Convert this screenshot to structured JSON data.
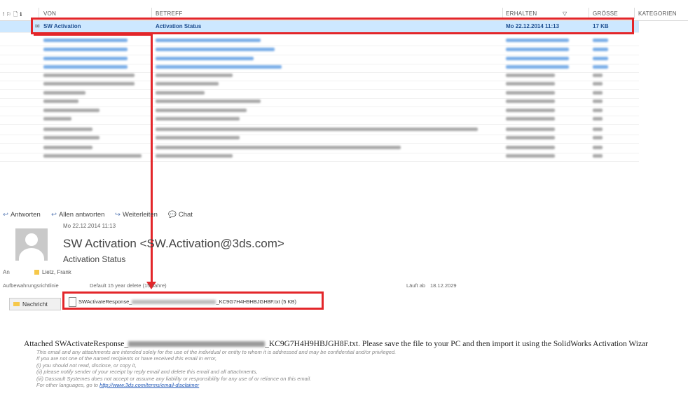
{
  "columns": {
    "icons": "! ⚐ 🗋 ℹ",
    "from": "VON",
    "subject": "BETREFF",
    "received": "ERHALTEN",
    "size": "GRÖSSE",
    "categories": "KATEGORIEN"
  },
  "selected_message": {
    "from": "SW Activation",
    "subject": "Activation Status",
    "received": "Mo 22.12.2014 11:13",
    "size": "17 KB"
  },
  "actions": {
    "reply": "Antworten",
    "reply_all": "Allen antworten",
    "forward": "Weiterleiten",
    "chat": "Chat"
  },
  "message": {
    "date": "Mo 22.12.2014 11:13",
    "sender": "SW Activation <SW.Activation@3ds.com>",
    "subject": "Activation Status",
    "to_label": "An",
    "to_name": "Lietz, Frank",
    "retention_label": "Aufbewahrungsrichtlinie",
    "retention_value": "Default 15 year delete (15 Jahre)",
    "expires_label": "Läuft ab",
    "expires_value": "18.12.2029"
  },
  "attachments": {
    "message_tab": "Nachricht",
    "file_prefix": "SWActivateResponse_",
    "file_suffix": "_KC9G7H4H9HBJGH8F.txt (5 KB)"
  },
  "body": {
    "main_prefix": "Attached SWActivateResponse_",
    "main_suffix": "_KC9G7H4H9HBJGH8F.txt. Please save the file to your PC and then import it using the SolidWorks Activation Wizar",
    "disclaimer": [
      "This email and any attachments are intended solely for the use of the individual or entity to whom it is addressed and may be confidential and/or privileged.",
      "If you are not one of the named recipients or have received this email in error,",
      "(i) you should not read, disclose, or copy it,",
      "(ii) please notify sender of your receipt by reply email and delete this email and all attachments,",
      "(iii) Dassault Systemes does not accept or assume any liability or responsibility for any use of or reliance on this email."
    ],
    "lang_prefix": "For other languages, go to ",
    "lang_link": "http://www.3ds.com/terms/email-disclaimer"
  },
  "colors": {
    "highlight": "#e3262a",
    "selection": "#cde8ff",
    "link": "#1d55b5"
  }
}
